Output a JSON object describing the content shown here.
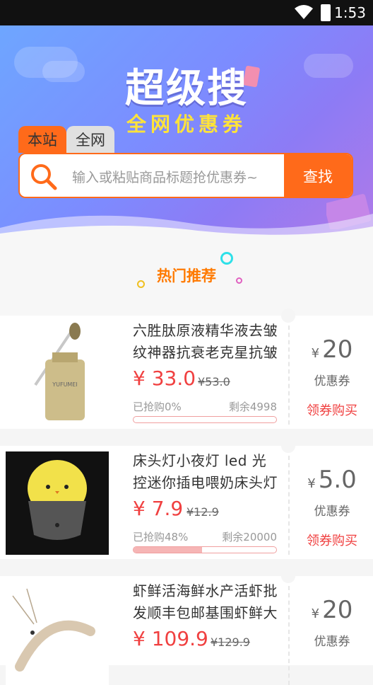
{
  "status": {
    "time": "1:53"
  },
  "hero": {
    "title": "超级搜",
    "subtitle": "全网优惠券"
  },
  "tabs": [
    {
      "label": "本站"
    },
    {
      "label": "全网"
    }
  ],
  "search": {
    "placeholder": "输入或粘贴商品标题抢优惠券~",
    "button": "查找"
  },
  "section": {
    "title": "热门推荐"
  },
  "colors": {
    "accent": "#ff6a1a",
    "price": "#f04040"
  },
  "products": [
    {
      "name": "六胜肽原液精华液去皱纹神器抗衰老克星抗皱",
      "price": "¥ 33.0",
      "original": "¥53.0",
      "sold": "已抢购0%",
      "remaining": "剩余4998",
      "progress": 0,
      "coupon_yen": "¥",
      "coupon_value": "20",
      "coupon_label": "优惠券",
      "action": "领券购买"
    },
    {
      "name": "床头灯小夜灯 led 光控迷你插电喂奶床头灯节",
      "price": "¥ 7.9",
      "original": "¥12.9",
      "sold": "已抢购48%",
      "remaining": "剩余20000",
      "progress": 48,
      "coupon_yen": "¥",
      "coupon_value": "5.0",
      "coupon_label": "优惠券",
      "action": "领券购买"
    },
    {
      "name": "虾鲜活海鲜水产活虾批发顺丰包邮基围虾鲜大",
      "price": "¥ 109.9",
      "original": "¥129.9",
      "sold": "",
      "remaining": "",
      "progress": 0,
      "coupon_yen": "¥",
      "coupon_value": "20",
      "coupon_label": "优惠券",
      "action": ""
    }
  ]
}
